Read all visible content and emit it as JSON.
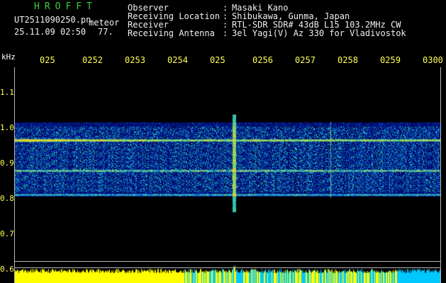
{
  "header": {
    "logo": "HROFFT",
    "filename": "UT2511090250.pn",
    "filename_suffix": "meteor",
    "datetime": "25.11.09 02:50",
    "value": "77."
  },
  "info": [
    {
      "key": "Observer",
      "value": "Masaki Kano"
    },
    {
      "key": "Receiving Location",
      "value": "Shibukawa, Gunma, Japan"
    },
    {
      "key": "Receiver",
      "value": "RTL-SDR SDR# 43dB L15 103.2MHz CW"
    },
    {
      "key": "Receiving Antenna",
      "value": "3el Yagi(V) Az 330 for Vladivostok"
    }
  ],
  "axis": {
    "y_unit": "kHz",
    "x_ticks": [
      "025",
      "025",
      "025",
      "025",
      "025",
      "025",
      "025",
      "025",
      "025",
      "0300"
    ],
    "x_tick_suffixes": [
      "",
      "2",
      "3",
      "4",
      "",
      "6",
      "7",
      "8",
      "9",
      ""
    ],
    "y_ticks": [
      "1.1",
      "1.0",
      "0.9",
      "0.8",
      "0.7",
      "0.6"
    ]
  },
  "colors": {
    "background": "#000000",
    "logo": "#37d237",
    "tick_labels": "#ffff55",
    "text": "#f0f0f0",
    "grid": "#b8b8b8",
    "bottom_bar_primary": "#ffff00",
    "bottom_bar_secondary": "#00c8ff"
  }
}
